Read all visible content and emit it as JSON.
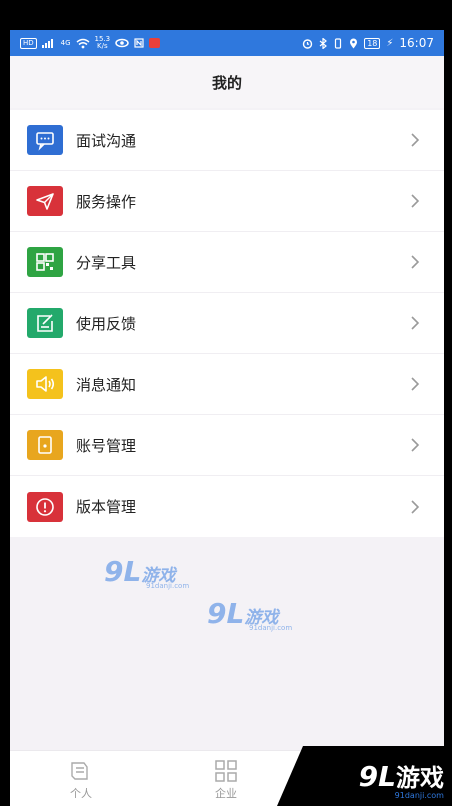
{
  "status_bar": {
    "network_tag": "HD",
    "net_gen": "4G",
    "speed_value": "15.3",
    "speed_unit": "K/s",
    "time": "16:07",
    "battery": "18"
  },
  "header": {
    "title": "我的"
  },
  "menu": {
    "items": [
      {
        "label": "面试沟通",
        "icon": "chat-icon",
        "color": "#2f6ed3"
      },
      {
        "label": "服务操作",
        "icon": "send-icon",
        "color": "#d8323a"
      },
      {
        "label": "分享工具",
        "icon": "qrcode-icon",
        "color": "#2fa443"
      },
      {
        "label": "使用反馈",
        "icon": "feedback-icon",
        "color": "#23a96b"
      },
      {
        "label": "消息通知",
        "icon": "speaker-icon",
        "color": "#f4c21c"
      },
      {
        "label": "账号管理",
        "icon": "account-icon",
        "color": "#e8a61e"
      },
      {
        "label": "版本管理",
        "icon": "alert-icon",
        "color": "#d8323a"
      }
    ]
  },
  "bottom_nav": {
    "tabs": [
      {
        "label": "个人",
        "icon": "person-icon"
      },
      {
        "label": "企业",
        "icon": "grid-icon"
      }
    ]
  },
  "watermarks": {
    "brand": "9L",
    "text": "游戏",
    "site": "91danji.com"
  }
}
